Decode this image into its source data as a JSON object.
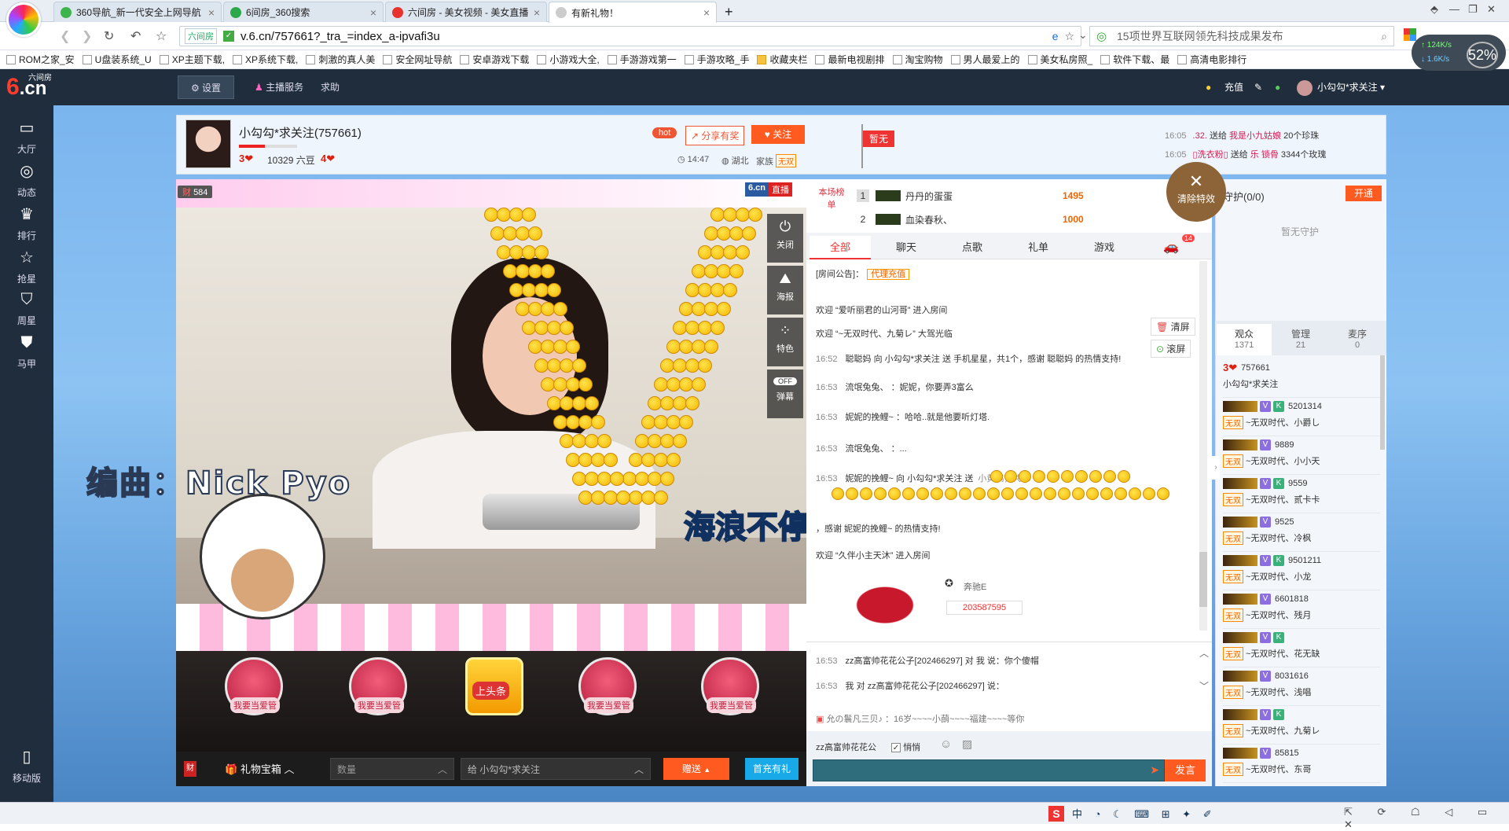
{
  "browser": {
    "tabs": [
      {
        "title": "360导航_新一代安全上网导航",
        "color": "#3cb44b"
      },
      {
        "title": "6间房_360搜索",
        "color": "#2aa84a"
      },
      {
        "title": "六间房 - 美女视频 - 美女直播",
        "color": "#e8322e"
      },
      {
        "title": "有新礼物！",
        "color": "#cccccc"
      }
    ],
    "url_site": "六间房",
    "url": "v.6.cn/757661?_tra_=index_a-ipvafi3u",
    "search_text": "15项世界互联网领先科技成果发布",
    "speed_up": "124K/s",
    "speed_down": "1.6K/s",
    "speed_pct": "52%",
    "bookmarks": [
      {
        "label": "ROM之家_安",
        "folder": false
      },
      {
        "label": "U盘装系统_U",
        "folder": false
      },
      {
        "label": "XP主题下载,",
        "folder": false
      },
      {
        "label": "XP系统下载,",
        "folder": false
      },
      {
        "label": "刺激的真人美",
        "folder": false
      },
      {
        "label": "安全网址导航",
        "folder": false
      },
      {
        "label": "安卓游戏下载",
        "folder": false
      },
      {
        "label": "小游戏大全,",
        "folder": false
      },
      {
        "label": "手游游戏第一",
        "folder": false
      },
      {
        "label": "手游攻略_手",
        "folder": false
      },
      {
        "label": "收藏夹栏",
        "folder": true
      },
      {
        "label": "最新电视剧排",
        "folder": false
      },
      {
        "label": "淘宝购物",
        "folder": false
      },
      {
        "label": "男人最爱上的",
        "folder": false
      },
      {
        "label": "美女私房照_",
        "folder": false
      },
      {
        "label": "软件下载、最",
        "folder": false
      },
      {
        "label": "高清电影排行",
        "folder": false
      }
    ]
  },
  "header": {
    "logo_top": "六间房",
    "logo_main": "6",
    "logo_dot": ".cn",
    "settings": "设置",
    "host_service": "主播服务",
    "help": "求助",
    "recharge": "充值",
    "username": "小勾勾*求关注"
  },
  "leftnav": [
    {
      "icon": "tv-icon",
      "label": "大厅"
    },
    {
      "icon": "compass-icon",
      "label": "动态"
    },
    {
      "icon": "crown-icon",
      "label": "排行"
    },
    {
      "icon": "star-icon",
      "label": "抢星"
    },
    {
      "icon": "basket-icon",
      "label": "周星"
    },
    {
      "icon": "shirt-icon",
      "label": "马甲"
    },
    {
      "icon": "phone-icon",
      "label": "移动版"
    }
  ],
  "anchor": {
    "name": "小勾勾*求关注(757661)",
    "level": "3",
    "beans": "10329 六豆",
    "fans": "4",
    "hot": "hot",
    "share": "分享有奖",
    "follow": "关注",
    "time": "14:47",
    "location": "湖北",
    "family": "家族",
    "family_badge": "无双",
    "flag": "暂无"
  },
  "announce": [
    {
      "time": "16:05",
      "prefix": ".32.",
      "action": " 送给 ",
      "to": "我是小九姑娘",
      "gift": " 20个珍珠"
    },
    {
      "time": "16:05",
      "prefix": "▯洗衣粉▯",
      "action": " 送给 ",
      "to": "乐 锁骨",
      "gift": " 3344个玫瑰"
    }
  ],
  "video": {
    "live": "直播",
    "site": "6.cn",
    "viewers": "584",
    "overlay_left": "编曲：Nick Pyo",
    "overlay_right": "海浪不停",
    "tools": [
      {
        "icon": "power-icon",
        "label": "关闭"
      },
      {
        "icon": "poster-icon",
        "label": "海报"
      },
      {
        "icon": "effects-icon",
        "label": "特色"
      },
      {
        "icon": "toggle-icon",
        "label": "弹幕",
        "toggle": "OFF"
      }
    ],
    "gift_buttons": [
      "我要当爱管",
      "我要当爱管",
      "上头条",
      "我要当爱管",
      "我要当爱管"
    ]
  },
  "giftbar": {
    "chest": "礼物宝箱",
    "qty_placeholder": "数量",
    "to_text": "给 小勾勾*求关注",
    "send": "赠送",
    "first_charge": "首充有礼"
  },
  "clear_effects": "清除特效",
  "rank": {
    "label": "本场榜单",
    "rows": [
      {
        "rank": "1",
        "name": "丹丹的蛋蛋",
        "score": "1495"
      },
      {
        "rank": "2",
        "name": "血染春秋、",
        "score": "1000"
      }
    ]
  },
  "chat_tabs": [
    "全部",
    "聊天",
    "点歌",
    "礼单",
    "游戏"
  ],
  "chat_tab_badge": "14",
  "chat_side": {
    "clear": "清屏",
    "scroll": "滚屏"
  },
  "chat": [
    {
      "time": "",
      "text": "[房间公告]：",
      "extra": "代理充值"
    },
    {
      "time": "",
      "text": "欢迎 “爱听丽君的山河哥” 进入房间",
      "extra": ""
    },
    {
      "time": "",
      "text": "欢迎 “~无双时代、九菊レ” 大驾光临",
      "extra": ""
    },
    {
      "time": "16:52",
      "text": "聪聪妈 向 小勾勾*求关注 送 手机星星，共1个，感谢 聪聪妈 的热情支持!",
      "extra": ""
    },
    {
      "time": "16:53",
      "text": "流氓兔兔、 ：妮妮，你要弄3富么",
      "extra": ""
    },
    {
      "time": "16:53",
      "text": "妮妮的挽鲤~ ：哈哈..就是他要听灯塔.",
      "extra": ""
    },
    {
      "time": "16:53",
      "text": "流氓兔兔、 ：...",
      "extra": ""
    },
    {
      "time": "16:53",
      "text": "妮妮的挽鲤~ 向 小勾勾*求关注 送",
      "extra": "小黄鸭，共50"
    },
    {
      "time": "",
      "text": "，感谢 妮妮的挽鲤~ 的热情支持!",
      "extra": ""
    },
    {
      "time": "",
      "text": "欢迎 “久伴小主天沐” 进入房间",
      "extra": ""
    }
  ],
  "car": {
    "brand": "奔驰E",
    "id": "203587595"
  },
  "private": [
    {
      "time": "16:53",
      "text": "zz高富帅花花公子[202466297] 对 我 说：你个傻帽"
    },
    {
      "time": "16:53",
      "text": "我 对 zz高富帅花花公子[202466297] 说："
    }
  ],
  "radio": "允の鬟凡三贝♪ ：16岁~~~~小蓢~~~~福建~~~~等你",
  "input": {
    "target": "zz高富帅花花公",
    "private_label": "悄悄",
    "send": "发言"
  },
  "guard": {
    "title": "守护(0/0)",
    "open": "开通",
    "empty": "暂无守护"
  },
  "aud_tabs": [
    {
      "label": "观众",
      "count": "1371"
    },
    {
      "label": "管理",
      "count": "21"
    },
    {
      "label": "麦序",
      "count": "0"
    }
  ],
  "audience": [
    {
      "id": "757661",
      "name": "小勾勾*求关注",
      "badge": "",
      "owner": true
    },
    {
      "id": "5201314",
      "name": "~无双时代、小爵し",
      "badge": "无双"
    },
    {
      "id": "9889",
      "name": "~无双时代、小小天",
      "badge": "无双"
    },
    {
      "id": "9559",
      "name": "~无双时代、贰卡卡",
      "badge": "无双"
    },
    {
      "id": "9525",
      "name": "~无双时代、冷枫",
      "badge": "无双"
    },
    {
      "id": "9501211",
      "name": "~无双时代、小龙",
      "badge": "无双"
    },
    {
      "id": "6601818",
      "name": "~无双时代、残月",
      "badge": "无双"
    },
    {
      "id": "",
      "name": "~无双时代、花无缺",
      "badge": "无双"
    },
    {
      "id": "8031616",
      "name": "~无双时代、浅唱",
      "badge": "无双"
    },
    {
      "id": "",
      "name": "~无双时代、九菊レ",
      "badge": "无双"
    },
    {
      "id": "85815",
      "name": "~无双时代、东哥",
      "badge": "无双"
    }
  ]
}
